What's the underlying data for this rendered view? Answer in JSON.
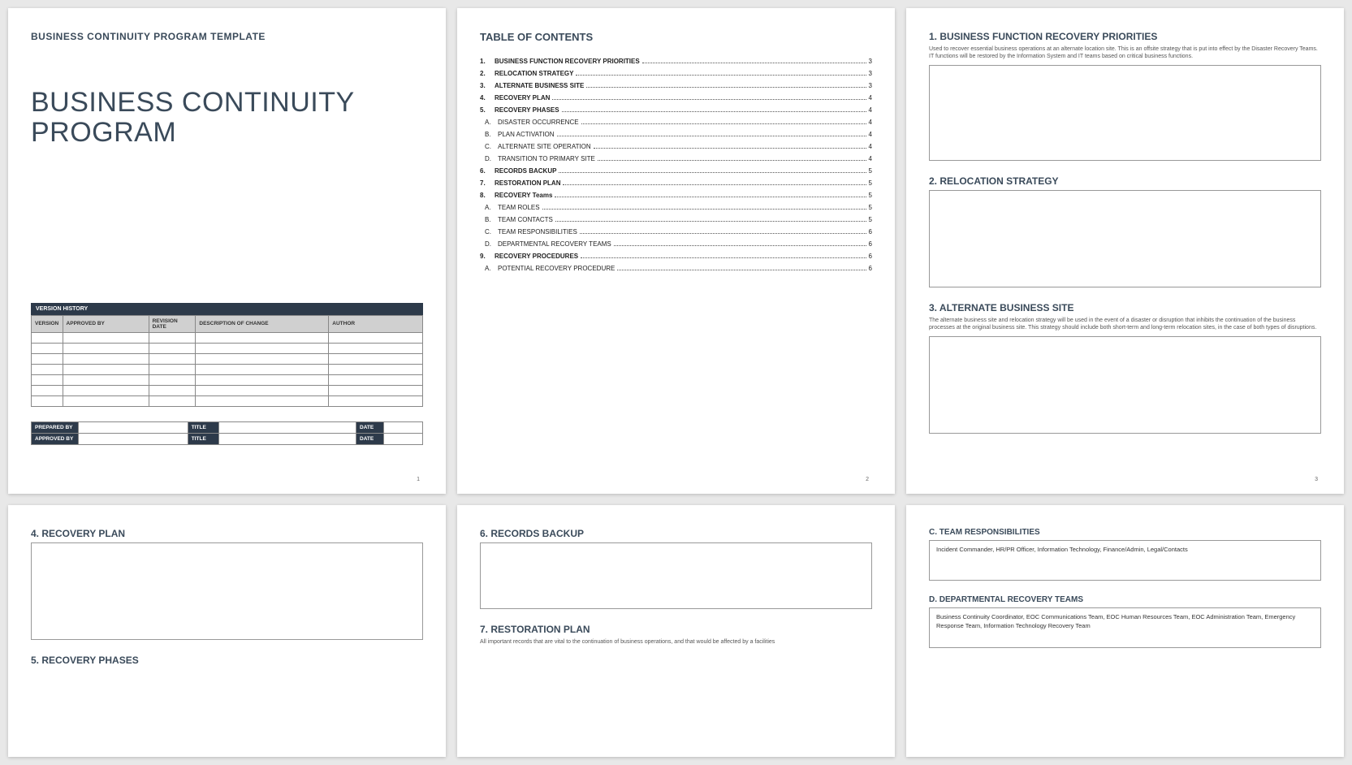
{
  "page1": {
    "eyebrow": "BUSINESS CONTINUITY PROGRAM TEMPLATE",
    "title_l1": "BUSINESS CONTINUITY",
    "title_l2": "PROGRAM",
    "vh_title": "VERSION HISTORY",
    "vh_cols": {
      "c1": "VERSION",
      "c2": "APPROVED BY",
      "c3": "REVISION DATE",
      "c4": "DESCRIPTION OF CHANGE",
      "c5": "AUTHOR"
    },
    "sig": {
      "prep": "PREPARED BY",
      "appr": "APPROVED BY",
      "title": "TITLE",
      "date": "DATE"
    },
    "num": "1"
  },
  "page2": {
    "title": "TABLE OF CONTENTS",
    "items": [
      {
        "n": "1.",
        "t": "BUSINESS FUNCTION RECOVERY PRIORITIES",
        "p": "3",
        "b": true
      },
      {
        "n": "2.",
        "t": "RELOCATION STRATEGY",
        "p": "3",
        "b": true
      },
      {
        "n": "3.",
        "t": "ALTERNATE BUSINESS SITE",
        "p": "3",
        "b": true
      },
      {
        "n": "4.",
        "t": "RECOVERY PLAN",
        "p": "4",
        "b": true
      },
      {
        "n": "5.",
        "t": "RECOVERY PHASES",
        "p": "4",
        "b": true
      },
      {
        "n": "A.",
        "t": "DISASTER OCCURRENCE",
        "p": "4",
        "b": false
      },
      {
        "n": "B.",
        "t": "PLAN ACTIVATION",
        "p": "4",
        "b": false
      },
      {
        "n": "C.",
        "t": "ALTERNATE SITE OPERATION",
        "p": "4",
        "b": false
      },
      {
        "n": "D.",
        "t": "TRANSITION TO PRIMARY SITE",
        "p": "4",
        "b": false
      },
      {
        "n": "6.",
        "t": "RECORDS BACKUP",
        "p": "5",
        "b": true
      },
      {
        "n": "7.",
        "t": "RESTORATION PLAN",
        "p": "5",
        "b": true
      },
      {
        "n": "8.",
        "t": "RECOVERY Teams",
        "p": "5",
        "b": true
      },
      {
        "n": "A.",
        "t": "TEAM ROLES",
        "p": "5",
        "b": false
      },
      {
        "n": "B.",
        "t": "TEAM CONTACTS",
        "p": "5",
        "b": false
      },
      {
        "n": "C.",
        "t": "TEAM RESPONSIBILITIES",
        "p": "6",
        "b": false
      },
      {
        "n": "D.",
        "t": "DEPARTMENTAL RECOVERY TEAMS",
        "p": "6",
        "b": false
      },
      {
        "n": "9.",
        "t": "RECOVERY PROCEDURES",
        "p": "6",
        "b": true
      },
      {
        "n": "A.",
        "t": "POTENTIAL RECOVERY PROCEDURE",
        "p": "6",
        "b": false
      }
    ],
    "num": "2"
  },
  "page3": {
    "s1_h": "1.  BUSINESS FUNCTION RECOVERY PRIORITIES",
    "s1_d": "Used to recover essential business operations at an alternate location site. This is an offsite strategy that is put into effect by the Disaster Recovery Teams. IT functions will be restored by the Information System and IT teams based on critical business functions.",
    "s2_h": "2.  RELOCATION STRATEGY",
    "s3_h": "3.  ALTERNATE BUSINESS SITE",
    "s3_d": "The alternate business site and relocation strategy will be used in the event of a disaster or disruption that inhibits the continuation of the business processes at the original business site. This strategy should include both short-term and long-term relocation sites, in the case of both types of disruptions.",
    "num": "3"
  },
  "page4": {
    "s4_h": "4.  RECOVERY PLAN",
    "s5_h": "5.  RECOVERY PHASES"
  },
  "page5": {
    "s6_h": "6.  RECORDS BACKUP",
    "s7_h": "7.  RESTORATION PLAN",
    "s7_d": "All important records that are vital to the continuation of business operations, and that would be affected by a facilities"
  },
  "page6": {
    "sc_h": "C.  TEAM RESPONSIBILITIES",
    "sc_t": "Incident Commander, HR/PR Officer, Information Technology, Finance/Admin, Legal/Contacts",
    "sd_h": "D.  DEPARTMENTAL RECOVERY TEAMS",
    "sd_t": "Business Continuity Coordinator, EOC Communications Team, EOC Human Resources Team, EOC Administration Team, Emergency Response Team, Information Technology Recovery Team"
  }
}
